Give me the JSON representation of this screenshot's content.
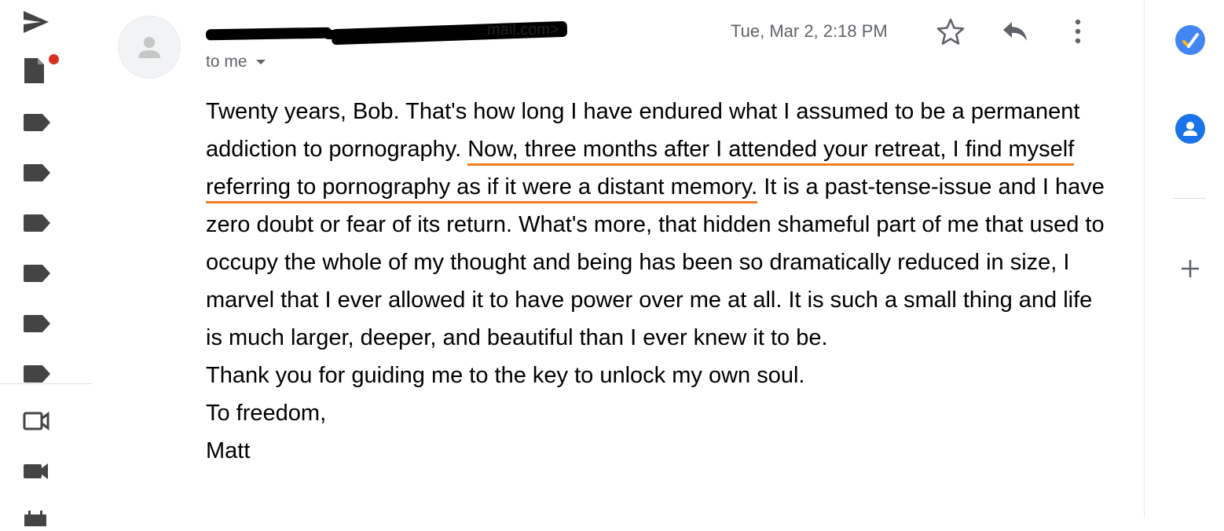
{
  "left_rail": {
    "icons": [
      "send-icon",
      "draft-icon",
      "label-icon",
      "label-icon",
      "label-icon",
      "label-icon",
      "label-icon",
      "label-icon",
      "video-call-icon",
      "camera-icon",
      "calendar-icon"
    ],
    "draft_badge_color": "#d93025"
  },
  "right_rail": {
    "addons": [
      "tasks-icon",
      "contacts-icon",
      "add-icon"
    ],
    "accent": "#1a73e8"
  },
  "message": {
    "sender_tail": "mail.com>",
    "recipient": "to me",
    "timestamp": "Tue, Mar 2, 2:18 PM"
  },
  "body": {
    "para1_before": "Twenty years, Bob. That's how long I have endured what I assumed to be a permanent addiction to pornography. ",
    "para1_highlight": "Now, three months after I attended your retreat, I find myself referring to pornography as if it were a distant memory.",
    "para1_after": " It is a past-tense-issue and I have zero doubt or fear of its return. What's more, that hidden shameful part of me that used to occupy the whole of my thought and being has been so dramatically reduced in size, I marvel that I ever allowed it to have power over me at all. It is such a small thing and life is much larger, deeper, and beautiful than I ever knew it to be.",
    "para2": "Thank you for guiding me to the key to unlock my own soul.",
    "closing": "To freedom,",
    "signature": "Matt",
    "highlight_color": "#f57c20"
  }
}
